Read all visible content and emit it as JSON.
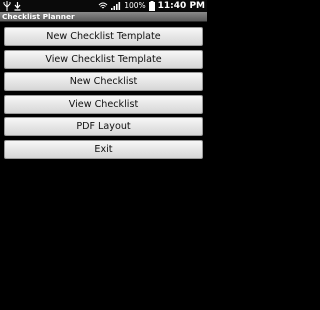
{
  "status_bar": {
    "notification_icons": [
      "usb-icon",
      "download-icon"
    ],
    "status_icons": [
      "wifi-icon",
      "signal-icon",
      "battery-icon"
    ],
    "battery_percent": "100%",
    "time": "11:40 PM"
  },
  "app": {
    "title": "Checklist Planner"
  },
  "menu": {
    "buttons": [
      {
        "label": "New Checklist Template"
      },
      {
        "label": "View Checklist Template"
      },
      {
        "label": "New Checklist"
      },
      {
        "label": "View Checklist"
      },
      {
        "label": "PDF Layout"
      },
      {
        "label": "Exit"
      }
    ]
  }
}
